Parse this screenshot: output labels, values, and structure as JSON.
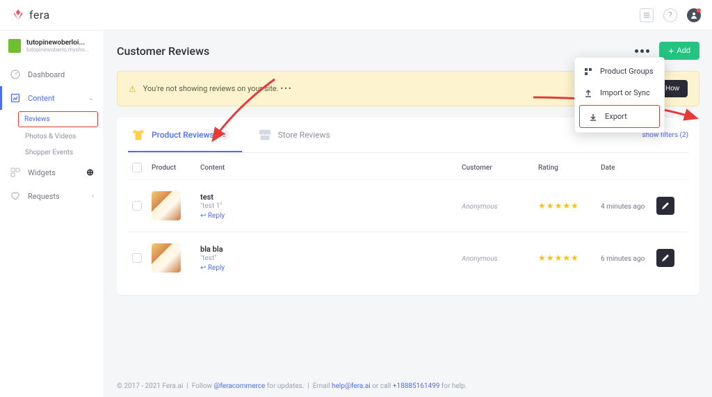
{
  "brand": "fera",
  "store": {
    "name": "tutopinewoberloi...",
    "sub": "tutopinewoberlo.mysho..."
  },
  "nav": {
    "dashboard": "Dashboard",
    "content": "Content",
    "content_children": {
      "reviews": "Reviews",
      "photos": "Photos & Videos",
      "events": "Shopper Events"
    },
    "widgets": "Widgets",
    "requests": "Requests"
  },
  "page": {
    "title": "Customer Reviews",
    "add": "Add"
  },
  "alert": {
    "text": "You're not showing reviews on your site.",
    "cta": "Show Me How"
  },
  "tabs": {
    "product": {
      "label": "Product Reviews",
      "count": "2"
    },
    "store": {
      "label": "Store Reviews"
    },
    "filters": "show filters (2)"
  },
  "dropdown": {
    "groups": "Product Groups",
    "import": "Import or Sync",
    "export": "Export"
  },
  "columns": {
    "product": "Product",
    "content": "Content",
    "customer": "Customer",
    "rating": "Rating",
    "date": "Date"
  },
  "rows": [
    {
      "title": "test",
      "sub": "\"test 1\"",
      "reply": "Reply",
      "customer": "Anonymous",
      "stars": "★★★★★",
      "date": "4 minutes ago"
    },
    {
      "title": "bla bla",
      "sub": "\"test\"",
      "reply": "Reply",
      "customer": "Anonymous",
      "stars": "★★★★★",
      "date": "6 minutes ago"
    }
  ],
  "footer": {
    "copyright": "© 2017 - 2021 Fera.ai",
    "follow": "Follow",
    "handle": "@feracommerce",
    "updates": "for updates.",
    "email_label": "Email",
    "email": "help@fera.ai",
    "or_call": "or call",
    "phone": "+18885161499",
    "help": "for help."
  }
}
